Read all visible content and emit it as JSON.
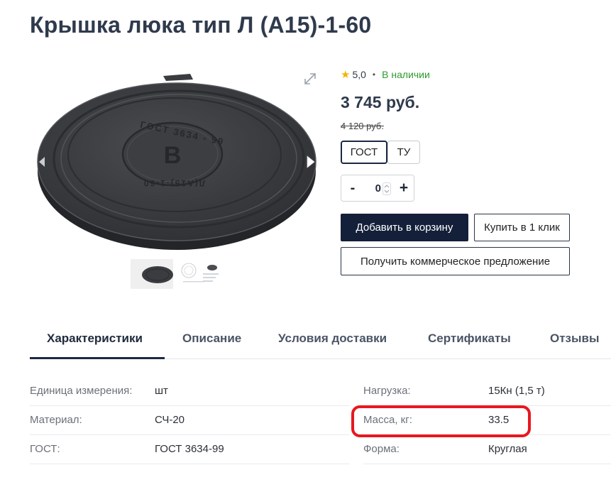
{
  "product": {
    "title": "Крышка люка тип Л (А15)-1-60",
    "cover_emboss": {
      "top": "ГОСТ 3634 - 99",
      "center": "В",
      "bottom": "Л(А15)-1-60"
    }
  },
  "rating": {
    "value": "5,0",
    "star": "★",
    "separator": "•",
    "stock": "В наличии"
  },
  "price": {
    "current": "3 745 руб.",
    "old": "4 120 руб."
  },
  "variants": [
    "ГОСТ",
    "ТУ"
  ],
  "quantity": {
    "minus": "-",
    "value": "0",
    "plus": "+",
    "spin": "⌃⌄"
  },
  "buttons": {
    "add_to_cart": "Добавить в корзину",
    "buy_one_click": "Купить в 1 клик",
    "get_offer": "Получить коммерческое предложение"
  },
  "tabs": [
    "Характеристики",
    "Описание",
    "Условия доставки",
    "Сертификаты",
    "Отзывы"
  ],
  "specs": {
    "left": [
      {
        "label": "Единица измерения:",
        "value": "шт"
      },
      {
        "label": "Материал:",
        "value": "СЧ-20"
      },
      {
        "label": "ГОСТ:",
        "value": "ГОСТ 3634-99"
      }
    ],
    "right": [
      {
        "label": "Нагрузка:",
        "value": "15Кн (1,5 т)"
      },
      {
        "label": "Масса, кг:",
        "value": "33.5"
      },
      {
        "label": "Форма:",
        "value": "Круглая"
      }
    ]
  },
  "icons": {
    "zoom": "expand-icon",
    "prev": "chevron-left-icon",
    "next": "chevron-right-icon",
    "rating": "star-icon"
  },
  "colors": {
    "primary": "#14203a",
    "stock_green": "#2e9a2e",
    "star": "#f4b400",
    "highlight": "#e8171f",
    "cover": "#3d3f42"
  }
}
